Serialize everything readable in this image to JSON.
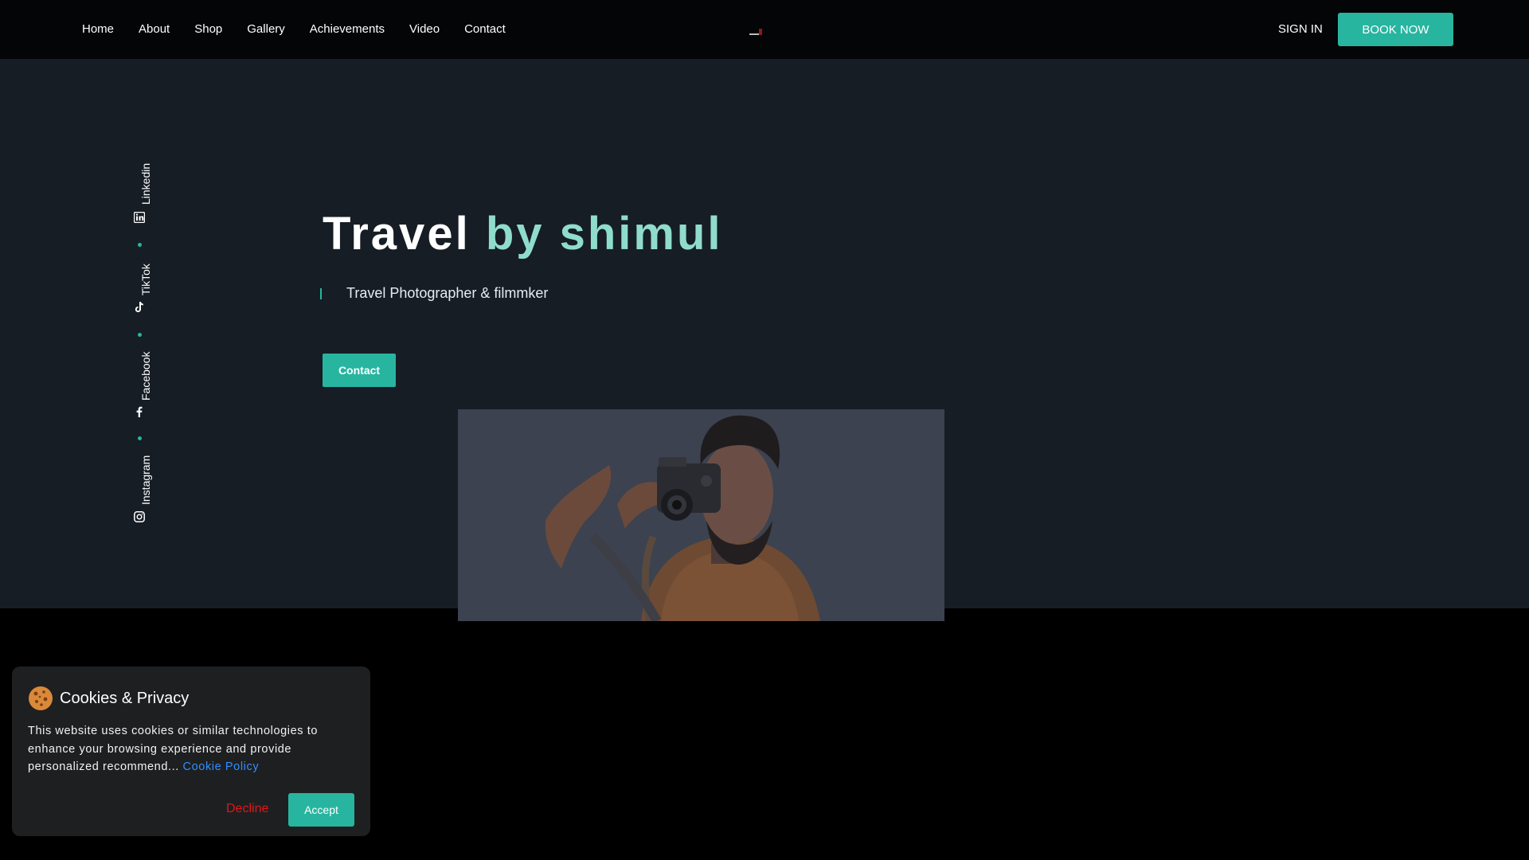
{
  "nav": {
    "links": [
      "Home",
      "About",
      "Shop",
      "Gallery",
      "Achievements",
      "Video",
      "Contact"
    ],
    "logo_icon": "brand-logo",
    "sign_in": "SIGN IN",
    "book_now": "BOOK NOW"
  },
  "social": [
    {
      "label": "Linkedin",
      "icon": "linkedin-icon"
    },
    {
      "label": "TikTok",
      "icon": "tiktok-icon"
    },
    {
      "label": "Facebook",
      "icon": "facebook-icon"
    },
    {
      "label": "Instagram",
      "icon": "instagram-icon"
    }
  ],
  "hero": {
    "title_word1": "Travel",
    "title_word2": "by shimul",
    "subtitle": "Travel Photographer & filmmker",
    "contact_button": "Contact"
  },
  "cookie": {
    "title": "Cookies & Privacy",
    "text": "This website uses cookies or similar technologies to enhance your browsing experience and provide personalized recommend...",
    "link": "Cookie Policy",
    "decline": "Decline",
    "accept": "Accept"
  },
  "colors": {
    "accent": "#27b5a0",
    "accent_light": "#8fdccd",
    "hero_bg": "#161d25",
    "decline": "#e01818",
    "link": "#2f8fff"
  }
}
